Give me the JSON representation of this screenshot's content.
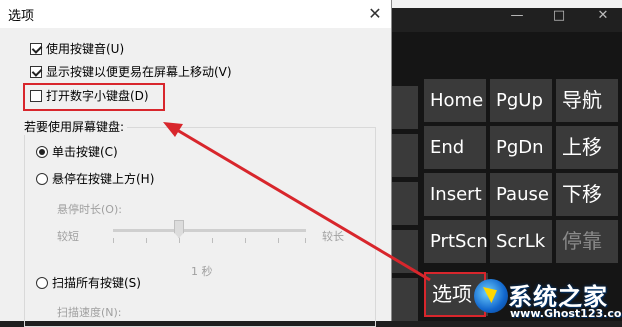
{
  "dialog": {
    "title": "选项",
    "close_glyph": "✕",
    "checkboxes": [
      {
        "label": "使用按键音(U)",
        "checked": true
      },
      {
        "label": "显示按键以便更易在屏幕上移动(V)",
        "checked": true
      },
      {
        "label": "打开数字小键盘(D)",
        "checked": false
      }
    ],
    "section_label": "若要使用屏幕键盘:",
    "radios": [
      {
        "label": "单击按键(C)",
        "checked": true
      },
      {
        "label": "悬停在按键上方(H)",
        "checked": false
      },
      {
        "label": "扫描所有按键(S)",
        "checked": false
      }
    ],
    "hover_duration_label": "悬停时长(O):",
    "slider_min_label": "较短",
    "slider_max_label": "较长",
    "slider_value_label": "1 秒",
    "scan_speed_label": "扫描速度(N):"
  },
  "osk": {
    "window_controls": [
      "—",
      "□",
      "✕"
    ],
    "keys": [
      [
        "Home",
        "PgUp",
        "导航"
      ],
      [
        "End",
        "PgDn",
        "上移"
      ],
      [
        "Insert",
        "Pause",
        "下移"
      ],
      [
        "PrtScn",
        "ScrLk",
        "停靠"
      ],
      [
        "选项"
      ]
    ]
  },
  "watermark": {
    "title": "系统之家",
    "url": "www.Ghost123.com"
  },
  "colors": {
    "highlight": "#d8262c",
    "key_bg": "#3a3a3a"
  }
}
